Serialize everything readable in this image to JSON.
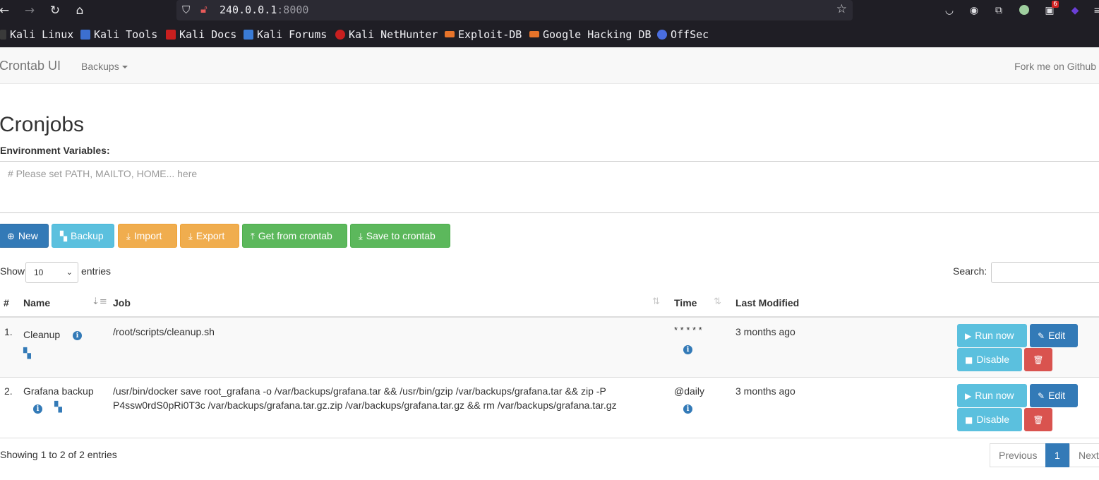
{
  "browser": {
    "url_host": "240.0.0.1",
    "url_port": ":8000",
    "notification_count": "6",
    "bookmarks": [
      {
        "label": "Kali Linux",
        "color": "#2a2a2a"
      },
      {
        "label": "Kali Tools",
        "color": "#3c6fcf"
      },
      {
        "label": "Kali Docs",
        "color": "#c81f1f"
      },
      {
        "label": "Kali Forums",
        "color": "#3a7bd5"
      },
      {
        "label": "Kali NetHunter",
        "color": "#c81f1f"
      },
      {
        "label": "Exploit-DB",
        "color": "#e8742a"
      },
      {
        "label": "Google Hacking DB",
        "color": "#e8742a"
      },
      {
        "label": "OffSec",
        "color": "#4a6ee0"
      }
    ]
  },
  "navbar": {
    "brand": "Crontab UI",
    "backups": "Backups",
    "fork": "Fork me on Github"
  },
  "page": {
    "title": "Cronjobs",
    "env_label": "Environment Variables:",
    "env_placeholder": "# Please set PATH, MAILTO, HOME... here"
  },
  "toolbar": {
    "new": "New",
    "backup": "Backup",
    "import": "Import",
    "export": "Export",
    "get_from_crontab": "Get from crontab",
    "save_to_crontab": "Save to crontab"
  },
  "table_controls": {
    "show": "Show",
    "page_size": "10",
    "entries": "entries",
    "search": "Search:"
  },
  "table": {
    "headers": [
      "#",
      "Name",
      "Job",
      "Time",
      "Last Modified"
    ],
    "rows": [
      {
        "num": "1.",
        "name": "Cleanup",
        "job_line1": "/root/scripts/cleanup.sh",
        "job_line2": "",
        "time": "* * * * *",
        "modified": "3 months ago"
      },
      {
        "num": "2.",
        "name": "Grafana backup",
        "job_line1": "/usr/bin/docker save root_grafana -o /var/backups/grafana.tar && /usr/bin/gzip /var/backups/grafana.tar && zip -P",
        "job_line2": "P4ssw0rdS0pRi0T3c /var/backups/grafana.tar.gz.zip /var/backups/grafana.tar.gz && rm /var/backups/grafana.tar.gz",
        "time": "@daily",
        "modified": "3 months ago"
      }
    ],
    "actions": {
      "run_now": "Run now",
      "edit": "Edit",
      "disable": "Disable"
    }
  },
  "footer": {
    "showing": "Showing 1 to 2 of 2 entries",
    "previous": "Previous",
    "page": "1",
    "next": "Next"
  }
}
